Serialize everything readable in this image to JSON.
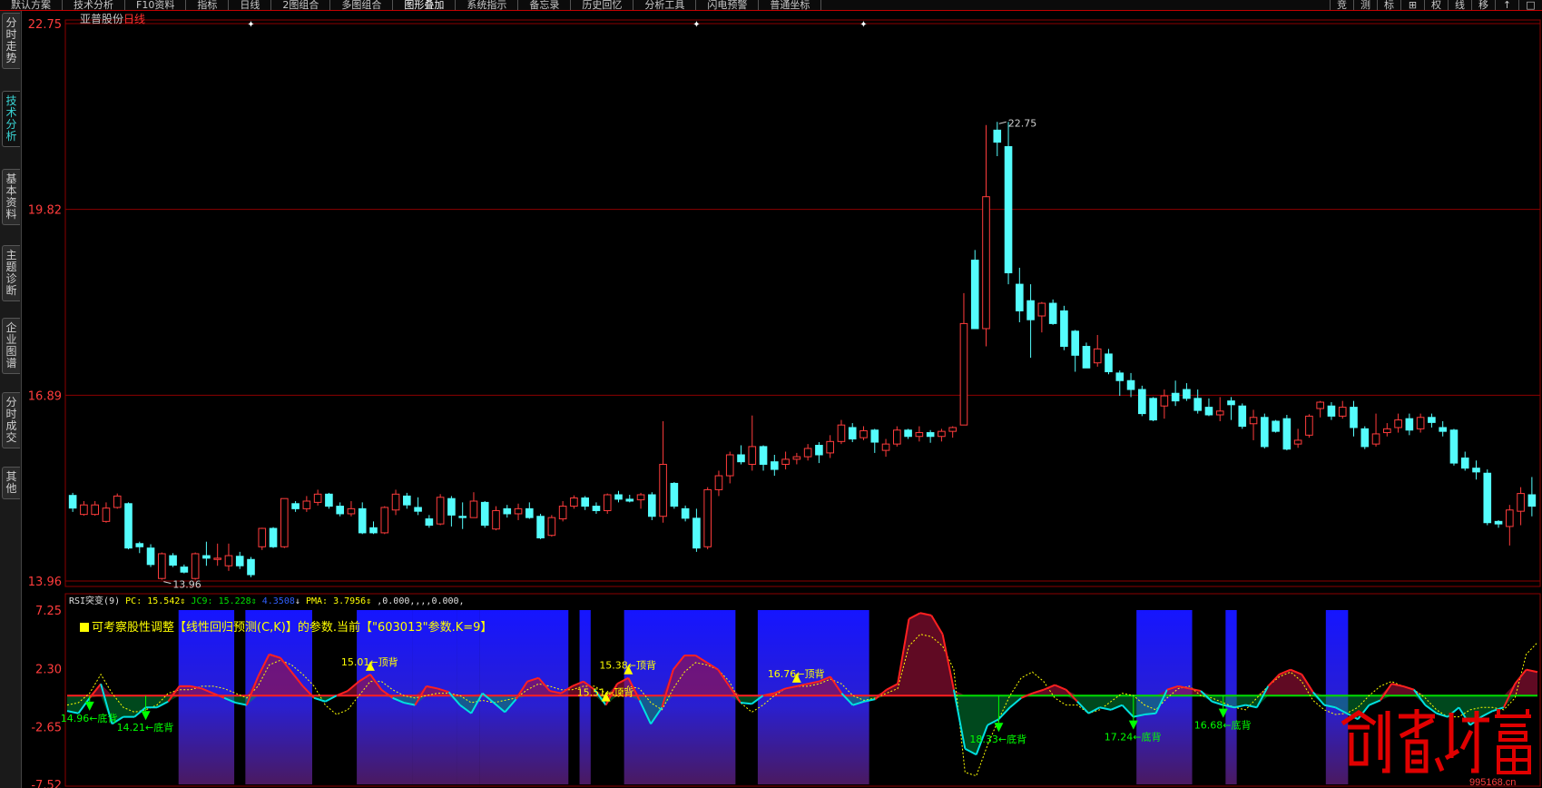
{
  "toolbar": {
    "items": [
      "默认方案",
      "技术分析",
      "F10资料",
      "指标",
      "日线",
      "2图组合",
      "多图组合",
      "图形叠加",
      "系统指示",
      "备忘录",
      "历史回忆",
      "分析工具",
      "闪电预警",
      "普通坐标"
    ],
    "active_index": 7,
    "right_buttons": [
      "竞",
      "测",
      "标",
      "⊞",
      "权",
      "线",
      "移",
      "↑",
      "□"
    ]
  },
  "sidebar": {
    "tabs": [
      "分时走势",
      "技术分析",
      "基本资料",
      "主题诊断",
      "企业图谱",
      "分时成交",
      "其他"
    ],
    "active_index": 1
  },
  "stock": {
    "name": "亚普股份",
    "period": "日线"
  },
  "price_axis": {
    "labels": [
      "22.75",
      "19.82",
      "16.89",
      "13.96"
    ]
  },
  "price_marks": {
    "high": "22.75",
    "low": "13.96"
  },
  "indicator": {
    "name": "RSI突变(9)",
    "pc_label": "PC:",
    "pc_value": "15.542",
    "jc_label": "JC9:",
    "jc_value": "15.228",
    "jc2_value": "4.3508",
    "pma_label": "PMA:",
    "pma_value": "3.7956",
    "extra": ",0.000,,,,0.000,",
    "note": "可考察股性调整【线性回归预测(C,K)】的参数.当前【\"603013\"参数.K=9】",
    "axis_labels": [
      "7.25",
      "2.30",
      "-2.65",
      "-7.52"
    ]
  },
  "signals": {
    "top": [
      {
        "price": "15.01",
        "text": "顶背"
      },
      {
        "price": "15.51",
        "text": "顶背"
      },
      {
        "price": "15.38",
        "text": "顶背"
      },
      {
        "price": "16.76",
        "text": "顶背"
      }
    ],
    "bottom": [
      {
        "price": "14.96",
        "text": "底背"
      },
      {
        "price": "14.21",
        "text": "底背"
      },
      {
        "price": "18.33",
        "text": "底背"
      },
      {
        "price": "17.24",
        "text": "底背"
      },
      {
        "price": "16.68",
        "text": "底背"
      }
    ]
  },
  "watermark": {
    "text": "创想财富",
    "url": "995168.cn"
  },
  "colors": {
    "up": "#ff3c3c",
    "down": "#54fcfc",
    "grid": "#8b0000",
    "axis_text": "#ff3c3c",
    "bottom_signal": "#00ff00",
    "top_signal": "#ffff00",
    "blue_band": "#1010ff",
    "zero_line": "#ff2020"
  },
  "chart_data": [
    {
      "type": "candlestick",
      "title": "亚普股份 日线",
      "y_ticks": [
        22.75,
        19.82,
        16.89,
        13.96
      ],
      "ylim": [
        13.96,
        22.75
      ],
      "candles": [
        [
          15.31,
          15.11,
          15.35,
          15.05
        ],
        [
          15.01,
          15.16,
          15.22,
          14.99
        ],
        [
          15.01,
          15.16,
          15.22,
          14.99
        ],
        [
          14.9,
          15.11,
          15.2,
          14.88
        ],
        [
          15.12,
          15.3,
          15.34,
          15.1
        ],
        [
          15.18,
          14.48,
          15.2,
          14.46
        ],
        [
          14.55,
          14.5,
          14.58,
          14.4
        ],
        [
          14.48,
          14.22,
          14.54,
          14.18
        ],
        [
          14.0,
          14.39,
          14.41,
          13.98
        ],
        [
          14.36,
          14.21,
          14.4,
          14.18
        ],
        [
          14.18,
          14.1,
          14.22,
          14.08
        ],
        [
          14.0,
          14.39,
          14.41,
          13.98
        ],
        [
          14.36,
          14.32,
          14.58,
          14.2
        ],
        [
          14.3,
          14.32,
          14.55,
          14.2
        ],
        [
          14.2,
          14.36,
          14.55,
          14.12
        ],
        [
          14.35,
          14.2,
          14.42,
          14.15
        ],
        [
          14.3,
          14.06,
          14.34,
          14.02
        ],
        [
          14.5,
          14.79,
          14.8,
          14.45
        ],
        [
          14.79,
          14.5,
          14.81,
          14.48
        ],
        [
          14.5,
          15.26,
          15.26,
          14.48
        ],
        [
          15.18,
          15.1,
          15.22,
          15.05
        ],
        [
          15.1,
          15.22,
          15.3,
          15.05
        ],
        [
          15.2,
          15.33,
          15.4,
          15.15
        ],
        [
          15.33,
          15.14,
          15.35,
          15.1
        ],
        [
          15.14,
          15.02,
          15.2,
          14.98
        ],
        [
          15.02,
          15.1,
          15.22,
          14.98
        ],
        [
          15.1,
          14.72,
          15.2,
          14.7
        ],
        [
          14.8,
          14.72,
          14.9,
          14.7
        ],
        [
          14.72,
          15.12,
          15.14,
          14.7
        ],
        [
          15.08,
          15.33,
          15.4,
          15.0
        ],
        [
          15.3,
          15.16,
          15.35,
          15.1
        ],
        [
          15.12,
          15.06,
          15.28,
          15.0
        ],
        [
          14.94,
          14.84,
          15.0,
          14.8
        ],
        [
          14.86,
          15.28,
          15.33,
          14.84
        ],
        [
          15.26,
          15.0,
          15.3,
          14.82
        ],
        [
          14.98,
          14.96,
          15.2,
          14.78
        ],
        [
          14.96,
          15.22,
          15.36,
          14.96
        ],
        [
          15.2,
          14.84,
          15.22,
          14.8
        ],
        [
          14.78,
          15.07,
          15.14,
          14.76
        ],
        [
          15.1,
          15.02,
          15.16,
          14.96
        ],
        [
          15.02,
          15.1,
          15.18,
          14.92
        ],
        [
          15.1,
          14.96,
          15.2,
          14.94
        ],
        [
          14.98,
          14.64,
          15.02,
          14.62
        ],
        [
          14.68,
          14.96,
          15.0,
          14.66
        ],
        [
          14.94,
          15.14,
          15.22,
          14.9
        ],
        [
          15.14,
          15.27,
          15.31,
          15.1
        ],
        [
          15.27,
          15.14,
          15.3,
          15.08
        ],
        [
          15.14,
          15.07,
          15.2,
          15.02
        ],
        [
          15.07,
          15.32,
          15.34,
          15.02
        ],
        [
          15.32,
          15.25,
          15.38,
          15.2
        ],
        [
          15.25,
          15.22,
          15.32,
          15.2
        ],
        [
          15.24,
          15.32,
          15.35,
          15.1
        ],
        [
          15.32,
          14.98,
          15.36,
          14.92
        ],
        [
          14.98,
          15.8,
          16.48,
          14.88
        ],
        [
          15.5,
          15.14,
          15.52,
          15.1
        ],
        [
          15.1,
          14.95,
          15.15,
          14.9
        ],
        [
          14.95,
          14.48,
          15.1,
          14.42
        ],
        [
          14.5,
          15.4,
          15.44,
          14.46
        ],
        [
          15.4,
          15.62,
          15.7,
          15.3
        ],
        [
          15.62,
          15.95,
          16.0,
          15.5
        ],
        [
          15.95,
          15.84,
          16.1,
          15.8
        ],
        [
          15.8,
          16.08,
          16.57,
          15.7
        ],
        [
          16.08,
          15.8,
          16.1,
          15.7
        ],
        [
          15.84,
          15.72,
          15.95,
          15.62
        ],
        [
          15.8,
          15.88,
          16.0,
          15.72
        ],
        [
          15.88,
          15.92,
          15.98,
          15.8
        ],
        [
          15.92,
          16.05,
          16.12,
          15.86
        ],
        [
          16.1,
          15.95,
          16.15,
          15.82
        ],
        [
          15.98,
          16.16,
          16.26,
          15.9
        ],
        [
          16.16,
          16.42,
          16.5,
          16.12
        ],
        [
          16.38,
          16.2,
          16.45,
          16.15
        ],
        [
          16.22,
          16.33,
          16.4,
          16.18
        ],
        [
          16.34,
          16.15,
          16.36,
          15.98
        ],
        [
          16.02,
          16.12,
          16.2,
          15.92
        ],
        [
          16.12,
          16.34,
          16.4,
          16.08
        ],
        [
          16.34,
          16.24,
          16.36,
          16.2
        ],
        [
          16.24,
          16.3,
          16.4,
          16.16
        ],
        [
          16.3,
          16.24,
          16.34,
          16.14
        ],
        [
          16.24,
          16.32,
          16.36,
          16.16
        ],
        [
          16.32,
          16.38,
          16.4,
          16.22
        ],
        [
          16.42,
          18.02,
          18.5,
          16.42
        ],
        [
          19.02,
          17.94,
          19.18,
          17.94
        ],
        [
          17.94,
          20.02,
          21.15,
          17.66
        ],
        [
          21.07,
          20.88,
          21.2,
          20.66
        ],
        [
          20.81,
          18.82,
          21.2,
          18.64
        ],
        [
          18.64,
          18.22,
          18.9,
          18.04
        ],
        [
          18.38,
          18.08,
          18.64,
          17.48
        ],
        [
          18.14,
          18.34,
          18.36,
          17.88
        ],
        [
          18.34,
          18.02,
          18.4,
          18.0
        ],
        [
          18.22,
          17.66,
          18.3,
          17.6
        ],
        [
          17.9,
          17.52,
          17.92,
          17.26
        ],
        [
          17.66,
          17.32,
          17.72,
          17.32
        ],
        [
          17.4,
          17.62,
          17.84,
          17.34
        ],
        [
          17.54,
          17.26,
          17.62,
          17.22
        ],
        [
          17.24,
          17.12,
          17.28,
          16.88
        ],
        [
          17.12,
          16.98,
          17.24,
          16.86
        ],
        [
          16.98,
          16.6,
          17.04,
          16.56
        ],
        [
          16.84,
          16.5,
          16.86,
          16.48
        ],
        [
          16.72,
          16.88,
          16.98,
          16.52
        ],
        [
          16.92,
          16.8,
          17.12,
          16.72
        ],
        [
          16.98,
          16.84,
          17.08,
          16.8
        ],
        [
          16.84,
          16.65,
          16.98,
          16.6
        ],
        [
          16.7,
          16.58,
          16.84,
          16.56
        ],
        [
          16.58,
          16.64,
          16.86,
          16.48
        ],
        [
          16.8,
          16.74,
          16.86,
          16.5
        ],
        [
          16.72,
          16.4,
          16.76,
          16.36
        ],
        [
          16.44,
          16.54,
          16.66,
          16.18
        ],
        [
          16.54,
          16.08,
          16.6,
          16.05
        ],
        [
          16.48,
          16.32,
          16.5,
          16.3
        ],
        [
          16.52,
          16.04,
          16.58,
          16.02
        ],
        [
          16.12,
          16.18,
          16.36,
          16.06
        ],
        [
          16.26,
          16.56,
          16.59,
          16.22
        ],
        [
          16.68,
          16.78,
          16.8,
          16.54
        ],
        [
          16.72,
          16.56,
          16.78,
          16.5
        ],
        [
          16.56,
          16.7,
          16.8,
          16.52
        ],
        [
          16.7,
          16.38,
          16.8,
          16.24
        ],
        [
          16.36,
          16.08,
          16.4,
          16.04
        ],
        [
          16.12,
          16.28,
          16.6,
          16.08
        ],
        [
          16.3,
          16.36,
          16.45,
          16.24
        ],
        [
          16.38,
          16.5,
          16.6,
          16.3
        ],
        [
          16.52,
          16.34,
          16.6,
          16.26
        ],
        [
          16.36,
          16.54,
          16.6,
          16.3
        ],
        [
          16.54,
          16.46,
          16.6,
          16.38
        ],
        [
          16.38,
          16.32,
          16.48,
          16.24
        ],
        [
          16.34,
          15.82,
          16.36,
          15.78
        ],
        [
          15.9,
          15.74,
          16.0,
          15.7
        ],
        [
          15.74,
          15.68,
          15.86,
          15.56
        ],
        [
          15.66,
          14.88,
          15.72,
          14.84
        ],
        [
          14.9,
          14.86,
          14.92,
          14.8
        ],
        [
          14.82,
          15.08,
          15.16,
          14.52
        ],
        [
          15.06,
          15.34,
          15.44,
          14.84
        ],
        [
          15.32,
          15.14,
          15.6,
          14.98
        ]
      ]
    },
    {
      "type": "line",
      "title": "RSI突变(9)",
      "y_ticks": [
        7.25,
        2.3,
        -2.65,
        -7.52
      ],
      "ylim": [
        -7.52,
        7.25
      ],
      "series": [
        {
          "name": "PC",
          "values": [
            -1.3,
            -1.5,
            -0.2,
            1.0,
            -2.4,
            -1.8,
            -1.8,
            -1.0,
            -1.0,
            -0.5,
            0.8,
            0.8,
            0.6,
            0.2,
            -0.2,
            -0.6,
            -0.8,
            1.6,
            3.5,
            3.2,
            2.0,
            0.8,
            -0.2,
            -0.5,
            0.0,
            0.4,
            1.2,
            1.8,
            0.5,
            -0.2,
            -0.6,
            -0.8,
            0.8,
            0.6,
            0.3,
            -0.8,
            -1.5,
            0.2,
            -0.6,
            -1.4,
            -0.3,
            1.2,
            1.5,
            0.4,
            0.2,
            0.8,
            1.2,
            0.5,
            -0.8,
            1.0,
            1.5,
            -0.4,
            -2.4,
            -1.0,
            2.2,
            3.4,
            3.4,
            2.8,
            2.2,
            0.8,
            -0.6,
            -0.7,
            0.0,
            0.2,
            0.6,
            0.8,
            1.0,
            1.2,
            1.6,
            0.2,
            -0.8,
            -0.5,
            -0.3,
            0.5,
            1.0,
            6.5,
            7.0,
            6.8,
            5.2,
            0.5,
            -4.5,
            -5.0,
            -2.5,
            -2.0,
            -1.0,
            -0.2,
            0.2,
            0.5,
            0.9,
            0.5,
            -0.5,
            -1.5,
            -1.0,
            -1.2,
            -0.8,
            -1.8,
            -1.6,
            -1.5,
            0.5,
            0.8,
            0.6,
            0.4,
            -0.5,
            -0.8,
            -1.0,
            -0.8,
            -1.0,
            0.8,
            1.8,
            2.2,
            1.8,
            0.3,
            -0.8,
            -1.0,
            -1.5,
            -2.0,
            -0.8,
            -0.4,
            1.0,
            0.8,
            0.5,
            -0.8,
            -1.5,
            -1.8,
            -1.0,
            -2.5,
            -1.8,
            -1.3,
            -1.0,
            1.0,
            2.2,
            2.0
          ]
        },
        {
          "name": "JC9",
          "values": [
            -0.8,
            -0.6,
            0.2,
            1.8,
            0.2,
            -1.0,
            -1.4,
            -1.2,
            -0.8,
            0.2,
            0.5,
            0.5,
            0.8,
            0.8,
            0.6,
            0.2,
            -0.2,
            0.8,
            2.6,
            3.0,
            2.6,
            1.8,
            0.8,
            -0.8,
            -1.6,
            -1.2,
            0.0,
            1.2,
            1.2,
            0.5,
            0.0,
            -0.2,
            0.0,
            0.2,
            0.2,
            0.0,
            -0.6,
            -0.4,
            -0.6,
            -0.4,
            -0.2,
            0.5,
            1.0,
            0.8,
            0.5,
            0.5,
            0.8,
            0.8,
            0.2,
            0.0,
            0.8,
            0.6,
            -0.6,
            -1.2,
            0.6,
            2.0,
            2.8,
            2.6,
            2.2,
            1.2,
            -0.6,
            -1.4,
            -0.8,
            0.0,
            0.6,
            0.8,
            0.8,
            1.0,
            1.4,
            1.0,
            0.0,
            -0.4,
            -0.2,
            0.2,
            0.6,
            4.2,
            5.2,
            5.0,
            4.2,
            2.2,
            -6.5,
            -6.8,
            -4.2,
            -2.0,
            0.0,
            1.5,
            2.0,
            1.2,
            -0.2,
            -0.8,
            -0.8,
            -1.5,
            -1.2,
            -0.5,
            0.2,
            0.0,
            -0.8,
            -1.2,
            -0.2,
            0.6,
            0.8,
            0.0,
            -0.2,
            -0.6,
            -1.0,
            -1.2,
            -0.2,
            0.8,
            1.6,
            2.0,
            1.2,
            -0.4,
            -1.2,
            -1.6,
            -1.5,
            -1.0,
            0.0,
            0.8,
            1.2,
            0.8,
            0.5,
            -0.2,
            -1.2,
            -1.8,
            -1.8,
            -1.2,
            -1.0,
            -1.0,
            -1.2,
            -0.2,
            3.5,
            4.5
          ]
        },
        {
          "name": "zero",
          "values": [
            0
          ]
        }
      ]
    }
  ]
}
